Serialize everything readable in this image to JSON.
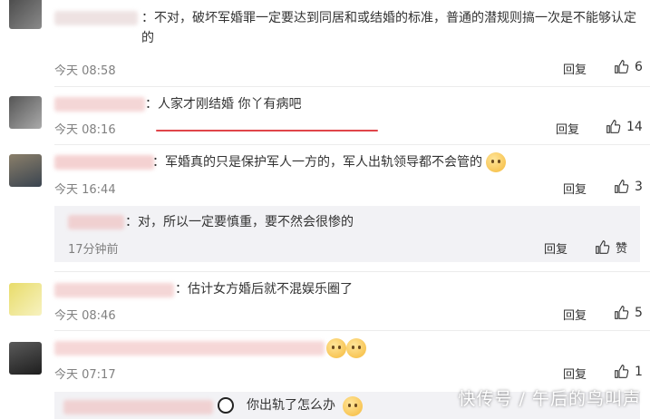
{
  "comments": [
    {
      "text": "：不对，破坏军婚罪一定要达到同居和或结婚的标准，普通的潜规则搞一次是不能够认定的",
      "time": "今天 08:58",
      "reply": "回复",
      "likes": "6"
    },
    {
      "text": "：人家才刚结婚 你丫有病吧",
      "time": "今天 08:16",
      "reply": "回复",
      "likes": "14"
    },
    {
      "text": "：军婚真的只是保护军人一方的，军人出轨领导都不会管的",
      "time": "今天 16:44",
      "reply": "回复",
      "likes": "3",
      "sub_reply": {
        "text": "：对，所以一定要慎重，要不然会很惨的",
        "time": "17分钟前",
        "reply": "回复",
        "likes": "赞"
      }
    },
    {
      "text": "：估计女方婚后就不混娱乐圈了",
      "time": "今天 08:46",
      "reply": "回复",
      "likes": "5"
    },
    {
      "text": "",
      "time": "今天 07:17",
      "reply": "回复",
      "likes": "1",
      "sub_reply_partial": {
        "text": "你出轨了怎么办"
      }
    }
  ],
  "watermark": "快传号 / 午后的鸟叫声",
  "colors": {
    "underline": "#e0454a",
    "sub_background": "#f2f2f5",
    "muted": "#808080"
  },
  "icons": [
    "thumbs-up-icon",
    "emoji-icon",
    "panda-emoji-icon"
  ]
}
